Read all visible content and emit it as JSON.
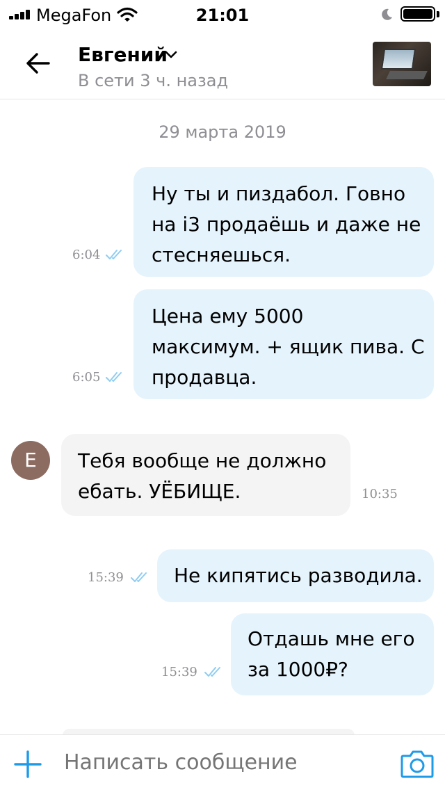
{
  "status_bar": {
    "carrier": "MegaFon",
    "time": "21:01"
  },
  "header": {
    "contact_name": "Евгений",
    "presence": "В сети 3 ч. назад"
  },
  "chat": {
    "date_separator": "29 марта 2019",
    "messages": [
      {
        "direction": "outgoing",
        "lines": [
          "Ну ты и пиздабол. Говно",
          "на i3 продаёшь и даже не",
          "стесняешься."
        ],
        "time": "6:04",
        "status": "read"
      },
      {
        "direction": "outgoing",
        "lines": [
          "Цена ему 5000",
          "максимум. + ящик пива. С",
          "продавца."
        ],
        "time": "6:05",
        "status": "read"
      },
      {
        "direction": "incoming",
        "avatar_letter": "Е",
        "lines": [
          "Тебя вообще не должно",
          "ебать. УЁБИЩЕ."
        ],
        "time": "10:35"
      },
      {
        "direction": "outgoing",
        "lines": [
          "Не кипятись разводила."
        ],
        "time": "15:39",
        "status": "read"
      },
      {
        "direction": "outgoing",
        "lines": [
          "Отдашь мне его",
          "за 1000₽?"
        ],
        "time": "15:39",
        "status": "read"
      }
    ]
  },
  "composer": {
    "placeholder": "Написать сообщение"
  },
  "colors": {
    "accent": "#1e9be8",
    "bubble_out": "#e5f3fc",
    "bubble_in": "#f4f4f4",
    "muted": "#8e8e93",
    "ticks": "#8fcdf2"
  },
  "icons": {
    "back": "arrow-left-icon",
    "attach": "plus-icon",
    "camera": "camera-icon",
    "read": "double-check-icon"
  }
}
